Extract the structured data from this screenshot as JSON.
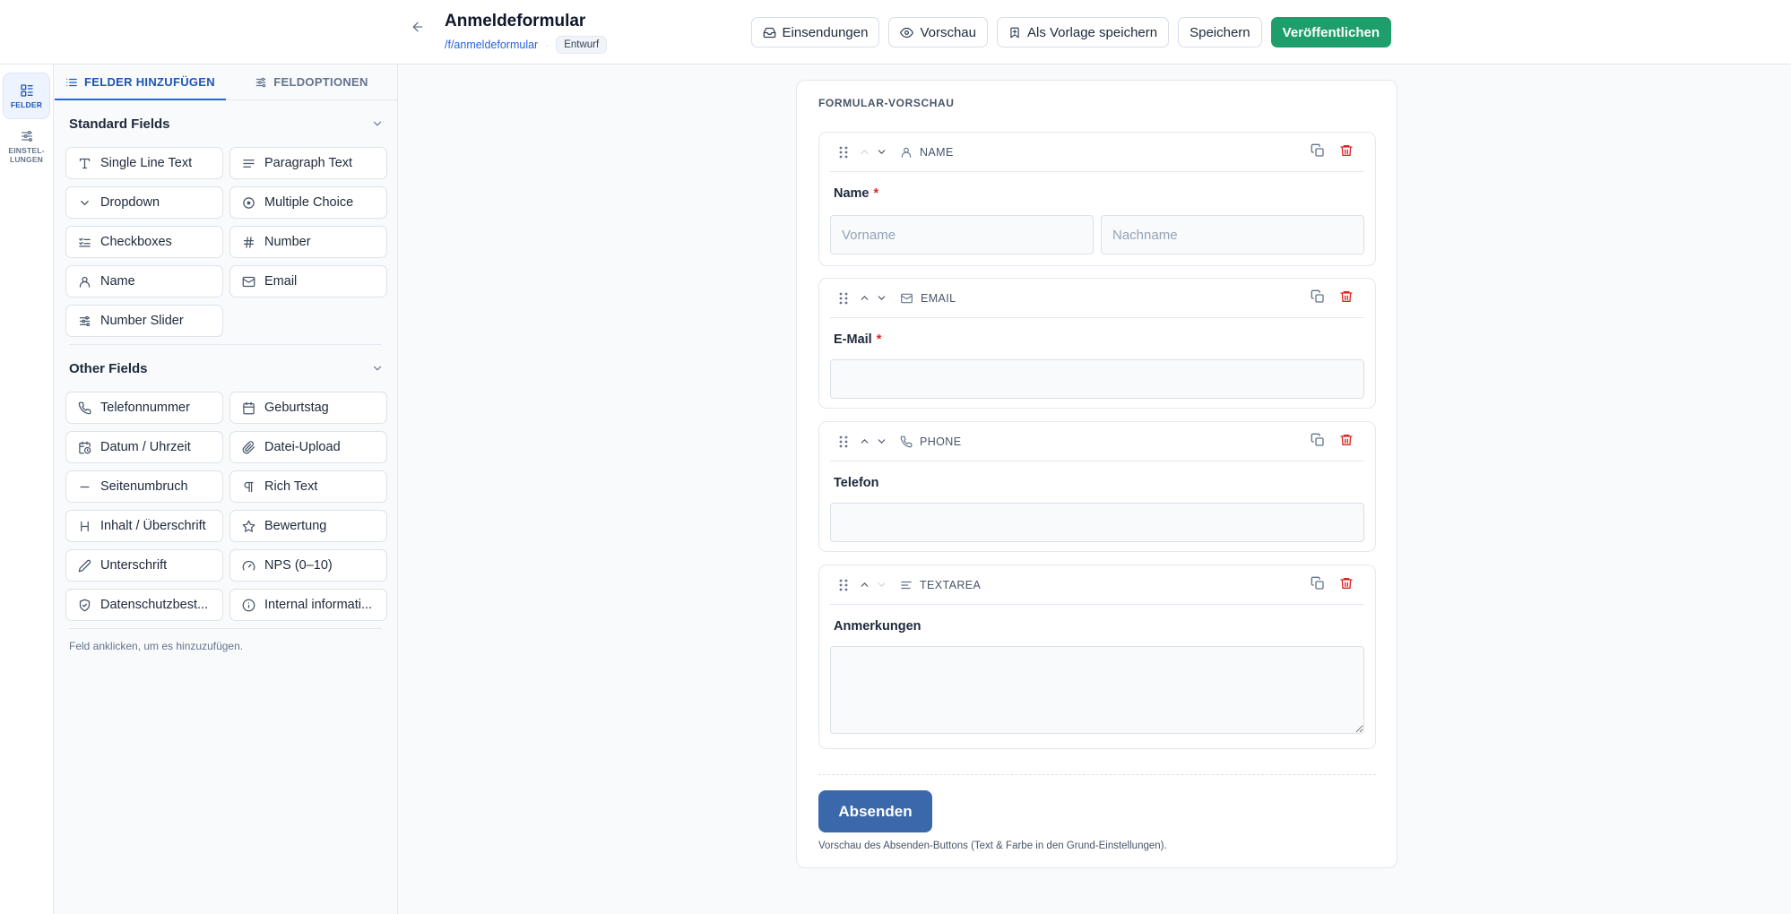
{
  "header": {
    "title": "Anmeldeformular",
    "slug": "/f/anmeldeformular",
    "separator": "·",
    "status": "Entwurf",
    "actions": {
      "submissions": "Einsendungen",
      "preview": "Vorschau",
      "save_template": "Als Vorlage speichern",
      "save": "Speichern",
      "publish": "Veröffentlichen"
    },
    "colors": {
      "publish": "#1e9e6a",
      "link": "#2563eb"
    }
  },
  "rail": {
    "fields": "FELDER",
    "settings_l1": "EINSTEL-",
    "settings_l2": "LUNGEN"
  },
  "sidebar": {
    "tabs": {
      "add_fields": "FELDER HINZUFÜGEN",
      "field_options": "FELDOPTIONEN"
    },
    "standard": {
      "title": "Standard Fields",
      "items": [
        {
          "label": "Single Line Text",
          "icon": "text-icon"
        },
        {
          "label": "Paragraph Text",
          "icon": "paragraph-icon"
        },
        {
          "label": "Dropdown",
          "icon": "chevron-down-icon"
        },
        {
          "label": "Multiple Choice",
          "icon": "radio-icon"
        },
        {
          "label": "Checkboxes",
          "icon": "checklist-icon"
        },
        {
          "label": "Number",
          "icon": "hash-icon"
        },
        {
          "label": "Name",
          "icon": "user-icon"
        },
        {
          "label": "Email",
          "icon": "mail-icon"
        },
        {
          "label": "Number Slider",
          "icon": "sliders-icon"
        }
      ]
    },
    "other": {
      "title": "Other Fields",
      "items": [
        {
          "label": "Telefonnummer",
          "icon": "phone-icon"
        },
        {
          "label": "Geburtstag",
          "icon": "calendar-icon"
        },
        {
          "label": "Datum / Uhrzeit",
          "icon": "calendar-clock-icon"
        },
        {
          "label": "Datei-Upload",
          "icon": "paperclip-icon"
        },
        {
          "label": "Seitenumbruch",
          "icon": "minus-icon"
        },
        {
          "label": "Rich Text",
          "icon": "pilcrow-icon"
        },
        {
          "label": "Inhalt / Überschrift",
          "icon": "heading-icon"
        },
        {
          "label": "Bewertung",
          "icon": "star-icon"
        },
        {
          "label": "Unterschrift",
          "icon": "pen-icon"
        },
        {
          "label": "NPS (0–10)",
          "icon": "gauge-icon"
        },
        {
          "label": "Datenschutzbest...",
          "icon": "shield-check-icon"
        },
        {
          "label": "Internal informati...",
          "icon": "info-icon"
        }
      ]
    },
    "hint": "Feld anklicken, um es hinzuzufügen."
  },
  "preview": {
    "label": "FORMULAR-VORSCHAU",
    "fields": {
      "name": {
        "type": "NAME",
        "label": "Name",
        "required": "*",
        "first_placeholder": "Vorname",
        "last_placeholder": "Nachname",
        "first_value": "",
        "last_value": ""
      },
      "email": {
        "type": "EMAIL",
        "label": "E-Mail",
        "required": "*",
        "value": ""
      },
      "phone": {
        "type": "PHONE",
        "label": "Telefon",
        "value": ""
      },
      "textarea": {
        "type": "TEXTAREA",
        "label": "Anmerkungen",
        "value": ""
      }
    },
    "submit": "Absenden",
    "submit_note": "Vorschau des Absenden-Buttons (Text & Farbe in den Grund-Einstellungen).",
    "colors": {
      "submit": "#3b68ab",
      "required": "#dc2626",
      "delete": "#dc2626"
    }
  }
}
